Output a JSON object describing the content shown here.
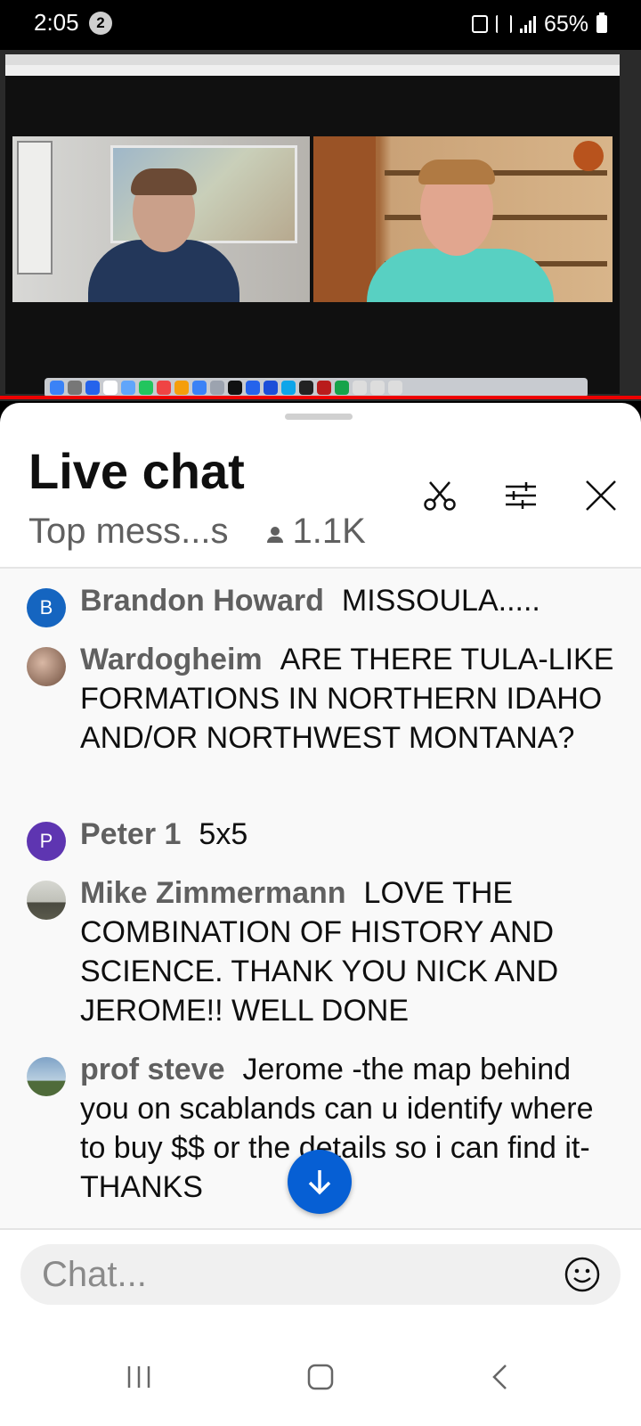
{
  "status_bar": {
    "time": "2:05",
    "notification_count": "2",
    "battery": "65%"
  },
  "chat": {
    "title": "Live chat",
    "mode": "Top mess...s",
    "viewers": "1.1K",
    "input_placeholder": "Chat...",
    "messages": [
      {
        "author": "Brandon Howard",
        "text": "MISSOULA.....",
        "avatar_letter": "B",
        "avatar_color": "#1565c0"
      },
      {
        "author": "Wardogheim",
        "text": "ARE THERE TULA-LIKE FORMATIONS IN NORTHERN IDAHO AND/OR NORTHWEST MONTANA?",
        "avatar_letter": "",
        "avatar_color": "#8a6d5a"
      },
      {
        "author": "Peter 1",
        "text": "5x5",
        "avatar_letter": "P",
        "avatar_color": "#5e35b1"
      },
      {
        "author": "Mike Zimmermann",
        "text": "LOVE THE COMBINATION OF HISTORY AND SCIENCE. THANK YOU NICK AND JEROME!! WELL DONE",
        "avatar_letter": "",
        "avatar_color": "#9e9e94"
      },
      {
        "author": "prof steve",
        "text": "Jerome -the map behind you on scablands can u identify where to buy $$ or the details so i can find it-THANKS",
        "avatar_letter": "",
        "avatar_color": "#6f8fb0"
      }
    ]
  },
  "icons": {
    "clip": "scissors-icon",
    "filter": "tune-icon",
    "close": "close-icon",
    "scroll": "arrow-down-icon",
    "emoji": "emoji-icon"
  },
  "colors": {
    "accent": "#065fd4",
    "live_progress": "#e00000"
  }
}
